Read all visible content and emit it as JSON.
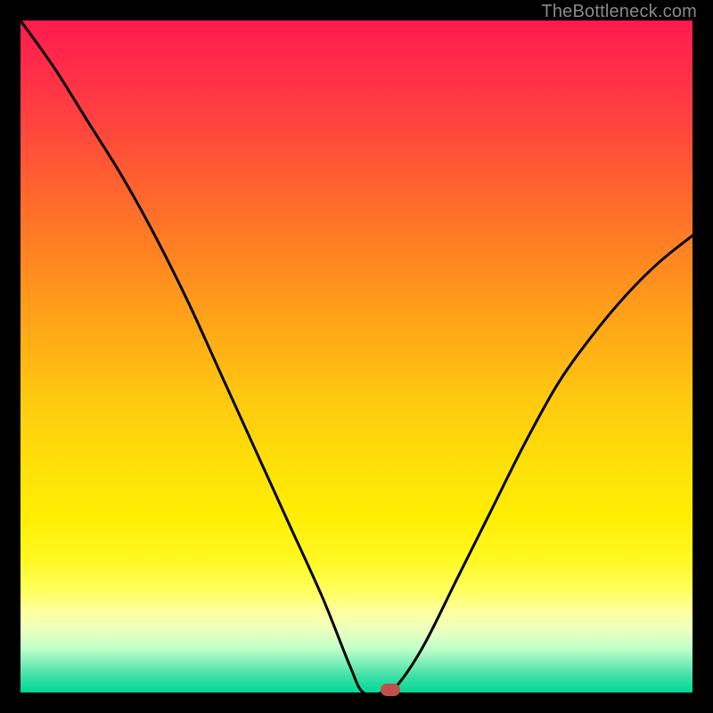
{
  "watermark": "TheBottleneck.com",
  "chart_data": {
    "type": "line",
    "title": "",
    "xlabel": "",
    "ylabel": "",
    "xlim": [
      0,
      100
    ],
    "ylim": [
      0,
      100
    ],
    "grid": false,
    "legend": false,
    "description": "Bottleneck curve on a red-to-green vertical gradient background. Y values represent bottleneck percentage (high=red top, low=green bottom). Curve descends from upper-left to a minimum near x≈55 then rises.",
    "series": [
      {
        "name": "bottleneck-curve",
        "color": "#000000",
        "x": [
          0,
          5,
          10,
          15,
          20,
          25,
          30,
          35,
          40,
          45,
          49,
          51,
          54,
          56,
          60,
          65,
          70,
          75,
          80,
          85,
          90,
          95,
          100
        ],
        "values": [
          100,
          93,
          85,
          77,
          68,
          58,
          47,
          36,
          25,
          14,
          4,
          0,
          0,
          1,
          7,
          17,
          27,
          37,
          46,
          53,
          59,
          64,
          68
        ]
      }
    ],
    "marker": {
      "x": 55,
      "y": 0,
      "color": "#c1504c"
    },
    "gradient_stops": [
      {
        "pos": 0,
        "color": "#ff1a4d"
      },
      {
        "pos": 0.5,
        "color": "#ffc400"
      },
      {
        "pos": 0.85,
        "color": "#ffff80"
      },
      {
        "pos": 1.0,
        "color": "#00d896"
      }
    ]
  }
}
